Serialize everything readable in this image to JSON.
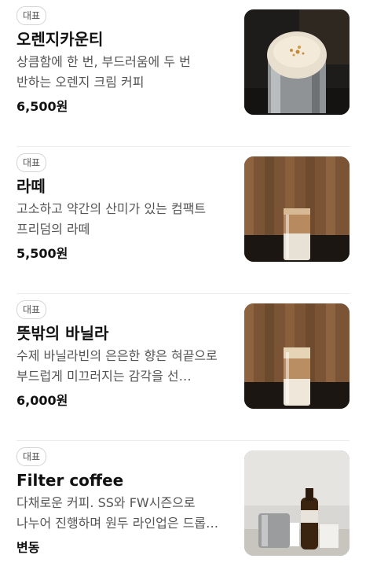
{
  "menu": [
    {
      "badge": "대표",
      "name": "오렌지카운티",
      "description": "상큼함에 한 번, 부드러움에 두 번 반하는 오렌지 크림 커피",
      "price": "6,500원"
    },
    {
      "badge": "대표",
      "name": "라떼",
      "description": "고소하고 약간의 산미가 있는 컴팩트 프리덤의 라떼",
      "price": "5,500원"
    },
    {
      "badge": "대표",
      "name": "뜻밖의 바닐라",
      "description": "수제 바닐라빈의 은은한 향은 혀끝으로 부드럽게 미끄러지는 감각을 선…",
      "price": "6,000원"
    },
    {
      "badge": "대표",
      "name": "Filter coffee",
      "description": "다채로운 커피. SS와 FW시즌으로 나누어 진행하며 원두 라인업은 드롭…",
      "price": "변동"
    }
  ]
}
